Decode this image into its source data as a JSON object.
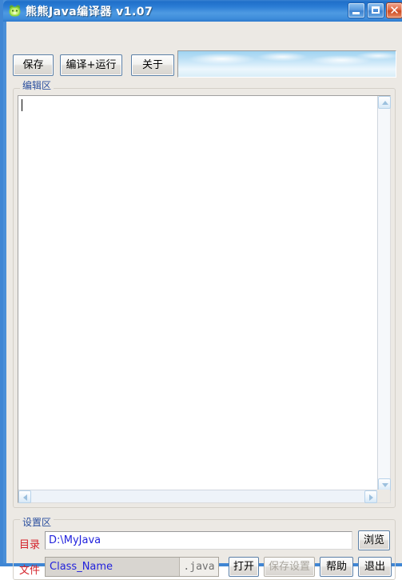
{
  "window": {
    "title": "熊熊Java编译器  v1.07",
    "icon": "bear-app-icon",
    "controls": {
      "minimize": "minimize-icon",
      "maximize": "maximize-icon",
      "close": "✕"
    },
    "frame_color": "#3f86d4",
    "titlebar_color": "#2a7cd4"
  },
  "toolbar": {
    "save_label": "保存",
    "compile_run_label": "编译+运行",
    "about_label": "关于",
    "banner": "sky-clouds-banner"
  },
  "editor_group": {
    "label": "编辑区",
    "content": "",
    "scrollbars": {
      "up": "scroll-up-icon",
      "down": "scroll-down-icon",
      "left": "scroll-left-icon",
      "right": "scroll-right-icon"
    }
  },
  "settings_group": {
    "label": "设置区",
    "directory": {
      "label": "目录",
      "value": "D:\\MyJava",
      "placeholder": ""
    },
    "file": {
      "label": "文件",
      "value": "Class_Name",
      "placeholder": "",
      "extension": ".java"
    },
    "buttons": {
      "browse": "浏览",
      "open": "打开",
      "save_settings": "保存设置",
      "help": "帮助",
      "exit": "退出"
    },
    "label_color": "#d4222a",
    "value_color": "#2222dd"
  }
}
